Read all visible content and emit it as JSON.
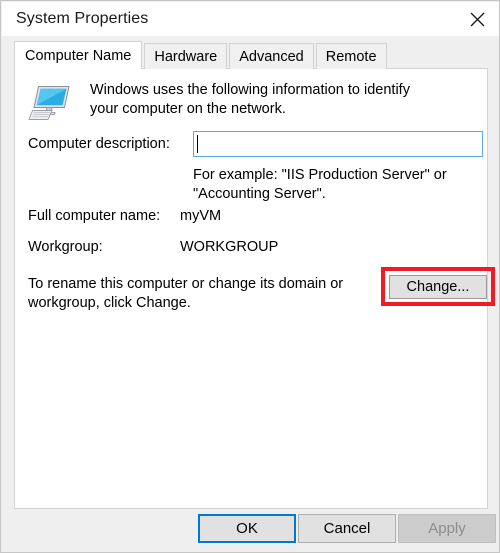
{
  "window": {
    "title": "System Properties",
    "close_icon": "close-x-icon"
  },
  "tabs": [
    {
      "label": "Computer Name",
      "active": true
    },
    {
      "label": "Hardware",
      "active": false
    },
    {
      "label": "Advanced",
      "active": false
    },
    {
      "label": "Remote",
      "active": false
    }
  ],
  "content": {
    "icon": "computer-monitor-icon",
    "intro_text": "Windows uses the following information to identify your computer on the network.",
    "description": {
      "label": "Computer description:",
      "value": "",
      "placeholder": "",
      "example_text": "For example: \"IIS Production Server\" or \"Accounting Server\"."
    },
    "full_computer_name": {
      "label": "Full computer name:",
      "value": "myVM"
    },
    "workgroup": {
      "label": "Workgroup:",
      "value": "WORKGROUP"
    },
    "rename_text": "To rename this computer or change its domain or workgroup, click Change.",
    "change_button_label": "Change..."
  },
  "footer": {
    "ok_label": "OK",
    "cancel_label": "Cancel",
    "apply_label": "Apply"
  },
  "colors": {
    "highlight_red": "#ee1c25",
    "focus_blue": "#0078d7",
    "input_border_blue": "#5aaae3",
    "window_bg": "#efefef",
    "panel_bg": "#ffffff"
  }
}
